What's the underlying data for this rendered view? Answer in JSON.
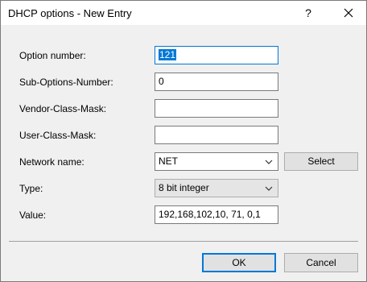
{
  "window": {
    "title": "DHCP options - New Entry",
    "help_glyph": "?"
  },
  "form": {
    "option_number": {
      "label": "Option number:",
      "value": "121"
    },
    "sub_options_number": {
      "label": "Sub-Options-Number:",
      "value": "0"
    },
    "vendor_class_mask": {
      "label": "Vendor-Class-Mask:",
      "value": ""
    },
    "user_class_mask": {
      "label": "User-Class-Mask:",
      "value": ""
    },
    "network_name": {
      "label": "Network name:",
      "value": "NET",
      "select_label": "Select"
    },
    "type": {
      "label": "Type:",
      "value": "8 bit integer"
    },
    "value": {
      "label": "Value:",
      "value": "192,168,102,10, 71, 0,1"
    }
  },
  "buttons": {
    "ok": "OK",
    "cancel": "Cancel"
  },
  "colors": {
    "accent": "#0078d7",
    "dialog_bg": "#f0f0f0"
  },
  "icons": [
    "help-icon",
    "close-icon",
    "chevron-down-icon"
  ]
}
